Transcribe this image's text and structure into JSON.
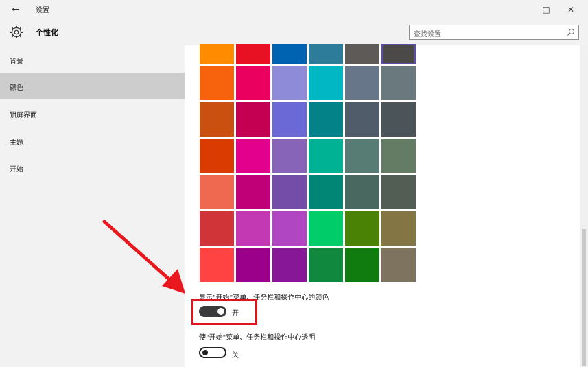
{
  "window": {
    "title": "设置",
    "back_icon": "back-arrow-icon",
    "minimize_glyph": "–",
    "maximize_glyph": "□",
    "close_glyph": "✕"
  },
  "header": {
    "icon": "gear-icon",
    "title": "个性化",
    "search": {
      "value": "查找设置",
      "icon": "search-icon"
    }
  },
  "sidebar": {
    "items": [
      {
        "label": "背景",
        "active": false
      },
      {
        "label": "颜色",
        "active": true
      },
      {
        "label": "锁屏界面",
        "active": false
      },
      {
        "label": "主题",
        "active": false
      },
      {
        "label": "开始",
        "active": false
      }
    ]
  },
  "colors": {
    "rows": [
      [
        "#ff8c00",
        "#e81123",
        "#0063b1",
        "#2d7d9a",
        "#5d5a58",
        "#4c4a48"
      ],
      [
        "#f7630c",
        "#ea005e",
        "#8e8cd8",
        "#00b7c3",
        "#68768a",
        "#69797e"
      ],
      [
        "#ca5010",
        "#c30052",
        "#6b69d6",
        "#038387",
        "#515c6b",
        "#4a5459"
      ],
      [
        "#da3b01",
        "#e3008c",
        "#8764b8",
        "#00b294",
        "#567c73",
        "#647c64"
      ],
      [
        "#ef6950",
        "#bf0077",
        "#744da9",
        "#018574",
        "#486860",
        "#525e54"
      ],
      [
        "#d13438",
        "#c239b3",
        "#b146c2",
        "#00cc6a",
        "#498205",
        "#847545"
      ],
      [
        "#ff4343",
        "#9a0089",
        "#881798",
        "#10893e",
        "#107c10",
        "#7e735f"
      ]
    ],
    "selected": "#4c4a48",
    "highlight": "#e0141b"
  },
  "settings": {
    "accent_on_start_label": "显示\"开始\"菜单、任务栏和操作中心的颜色",
    "accent_on_start_state": "开",
    "accent_on_start_on": true,
    "transparency_label": "使\"开始\"菜单、任务栏和操作中心透明",
    "transparency_state": "关",
    "transparency_on": false
  }
}
